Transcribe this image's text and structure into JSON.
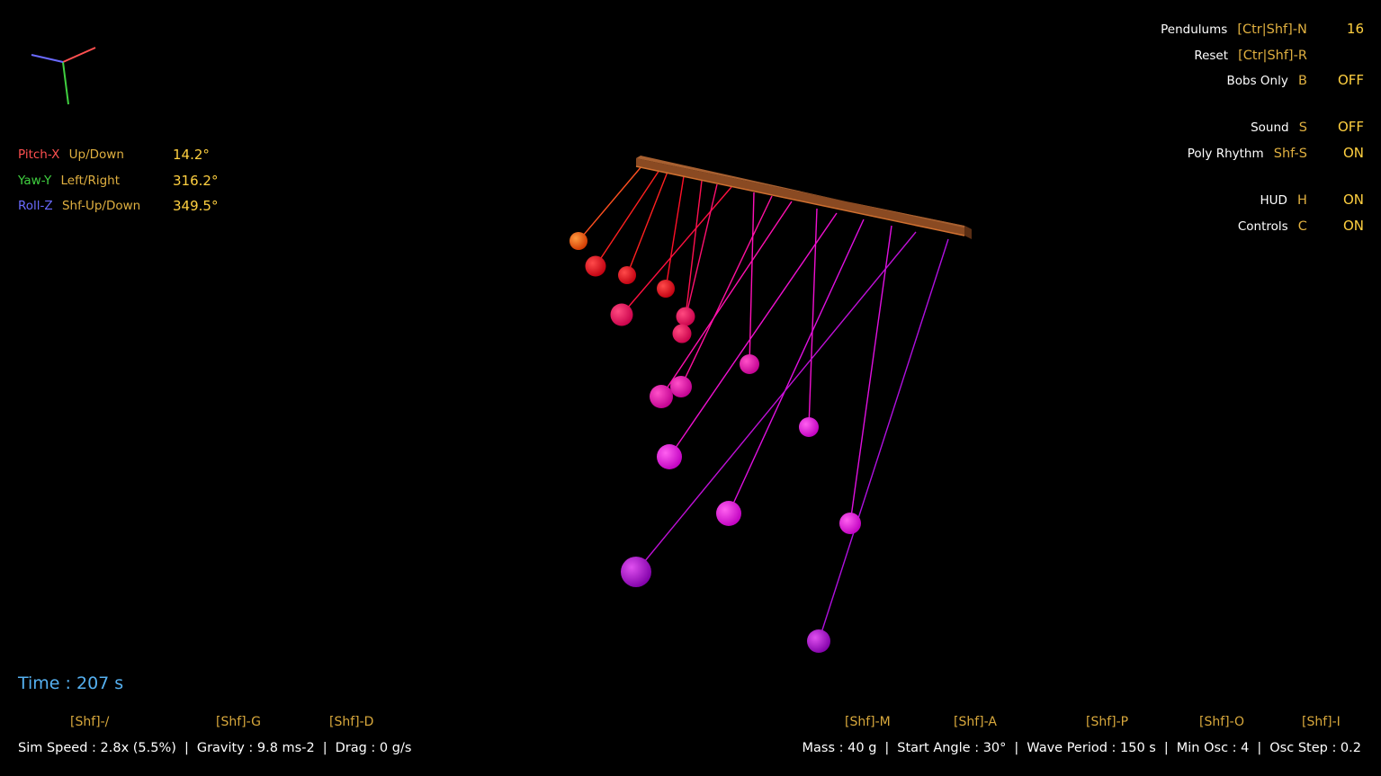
{
  "orientation": [
    {
      "axis": "Pitch-X",
      "axis_color": "#ff5050",
      "control": "Up/Down",
      "value": "14.2°"
    },
    {
      "axis": "Yaw-Y",
      "axis_color": "#40d040",
      "control": "Left/Right",
      "value": "316.2°"
    },
    {
      "axis": "Roll-Z",
      "axis_color": "#6a6aff",
      "control": "Shf-Up/Down",
      "value": "349.5°"
    }
  ],
  "hud": {
    "pendulums": {
      "label": "Pendulums",
      "key": "[Ctr|Shf]-N",
      "value": "16"
    },
    "reset": {
      "label": "Reset",
      "key": "[Ctr|Shf]-R",
      "value": ""
    },
    "bobs_only": {
      "label": "Bobs Only",
      "key": "B",
      "value": "OFF"
    },
    "sound": {
      "label": "Sound",
      "key": "S",
      "value": "OFF"
    },
    "poly_rhythm": {
      "label": "Poly Rhythm",
      "key": "Shf-S",
      "value": "ON"
    },
    "hud": {
      "label": "HUD",
      "key": "H",
      "value": "ON"
    },
    "controls": {
      "label": "Controls",
      "key": "C",
      "value": "ON"
    }
  },
  "time": "Time : 207 s",
  "left_keys": [
    "[Shf]-/",
    "[Shf]-G",
    "[Shf]-D"
  ],
  "left_status": [
    "Sim Speed : 2.8x (5.5%)",
    "Gravity : 9.8 ms-2",
    "Drag : 0 g/s"
  ],
  "right_keys": [
    "[Shf]-M",
    "[Shf]-A",
    "[Shf]-P",
    "[Shf]-O",
    "[Shf]-I"
  ],
  "right_status": [
    "Mass : 40 g",
    "Start Angle : 30°",
    "Wave Period : 150 s",
    "Min Osc : 4",
    "Osc Step : 0.2"
  ],
  "colors": {
    "bar": "#8a4a22",
    "bob_start": "#ff5a00",
    "bob_end": "#a000c8"
  }
}
